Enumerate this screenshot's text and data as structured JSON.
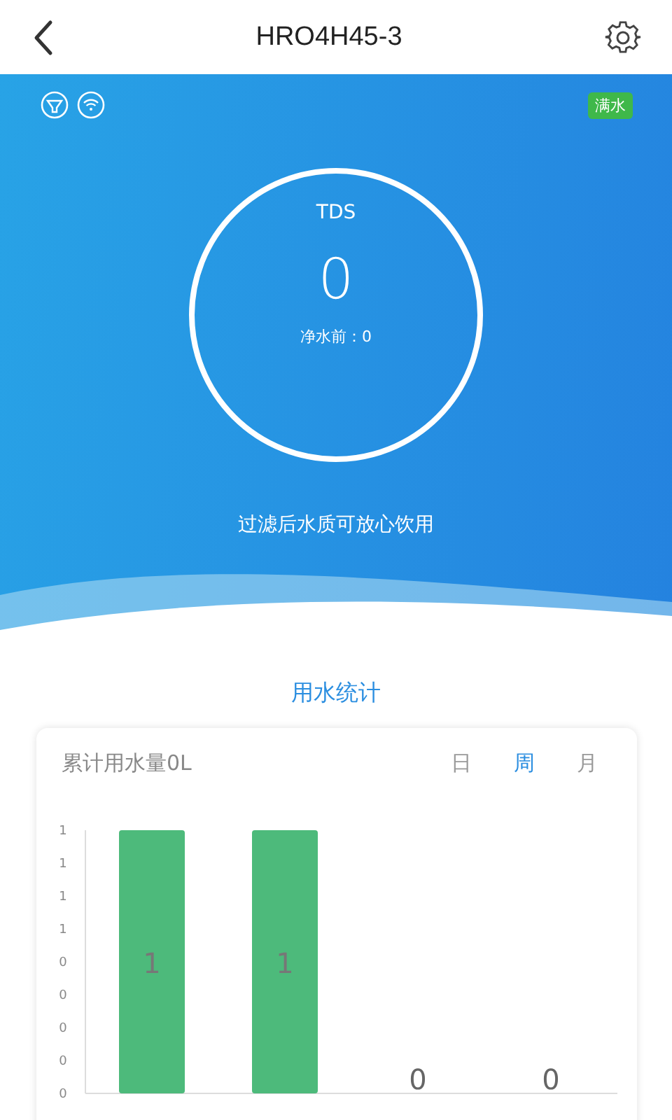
{
  "header": {
    "title": "HRO4H45-3"
  },
  "status": {
    "badge": "满水"
  },
  "gauge": {
    "label": "TDS",
    "value": "0",
    "before_label": "净水前：0"
  },
  "message": "过滤后水质可放心饮用",
  "stats": {
    "title": "用水统计",
    "total": "累计用水量0L",
    "periods": [
      {
        "label": "日",
        "selected": false
      },
      {
        "label": "周",
        "selected": true
      },
      {
        "label": "月",
        "selected": false
      }
    ],
    "chart_data": {
      "type": "bar",
      "categories": [
        null,
        null,
        null,
        null
      ],
      "values": [
        1,
        1,
        0,
        0
      ],
      "data_labels": true,
      "ylim": [
        0,
        1
      ],
      "yticks": [
        {
          "value": 1,
          "label": "1"
        },
        {
          "value": 0.875,
          "label": "1"
        },
        {
          "value": 0.75,
          "label": "1"
        },
        {
          "value": 0.625,
          "label": "1"
        },
        {
          "value": 0.5,
          "label": "0"
        },
        {
          "value": 0.375,
          "label": "0"
        },
        {
          "value": 0.25,
          "label": "0"
        },
        {
          "value": 0.125,
          "label": "0"
        },
        {
          "value": 0,
          "label": "0"
        }
      ]
    }
  }
}
